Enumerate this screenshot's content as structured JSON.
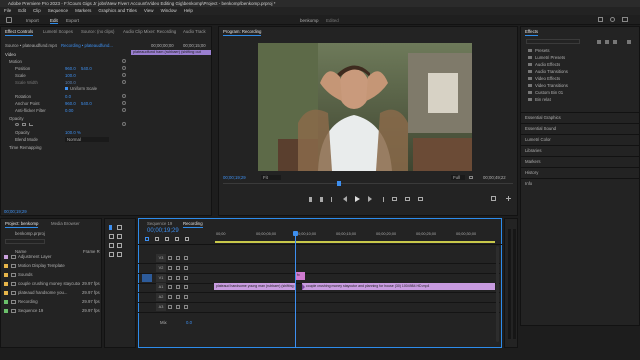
{
  "app": {
    "title": "Adobe Premiere Pro 2023 - F:\\Cours Gigs Jr jobs\\New Fiverr Account\\Video Editing Gig\\benkomp\\Project - benkomp\\benkomp.prproj *",
    "menus": [
      "File",
      "Edit",
      "Clip",
      "Sequence",
      "Markers",
      "Graphics and Titles",
      "View",
      "Window",
      "Help"
    ],
    "workspace_tabs": [
      "Import",
      "Edit",
      "Export"
    ],
    "active_workspace": "Edit",
    "project_center": "benkomp",
    "project_center_status": "Edited"
  },
  "effect_controls": {
    "tabs": [
      "Effect Controls",
      "Lumetri Scopes",
      "Source: (no clips)",
      "Audio Clip Mixer: Recording",
      "Audio Track"
    ],
    "source_label": "Source • plateaudfund.mp4",
    "sequence_label": "Recording • plateaudfund...",
    "ruler_times": [
      "00;00;00;00",
      "00;00;15;00"
    ],
    "clip_bar_label": "plateaudfund ham (ruhbaer) (shifting out",
    "section_video": "Video",
    "fx_motion": "Motion",
    "rows": [
      {
        "label": "Position",
        "v1": "960.0",
        "v2": "540.0"
      },
      {
        "label": "Scale",
        "v1": "100.0",
        "v2": ""
      },
      {
        "label": "Scale Width",
        "v1": "100.0",
        "v2": ""
      },
      {
        "label": "Uniform Scale",
        "v1": "",
        "v2": ""
      },
      {
        "label": "Rotation",
        "v1": "0.0",
        "v2": ""
      },
      {
        "label": "Anchor Point",
        "v1": "960.0",
        "v2": "540.0"
      },
      {
        "label": "Anti-flicker Filter",
        "v1": "0.00",
        "v2": ""
      }
    ],
    "fx_opacity": "Opacity",
    "opacity_rows": [
      {
        "label": "Opacity",
        "v1": "100.0 %"
      },
      {
        "label": "Blend Mode",
        "v1": "Normal"
      }
    ],
    "fx_time_remap": "Time Remapping",
    "bottom_time": "00;00;19;29"
  },
  "program_monitor": {
    "title": "Program: Recording",
    "timecode_left": "00;00;19;29",
    "fit": "Fit",
    "quality": "Full",
    "timecode_right": "00;00;49;22"
  },
  "effects_panel": {
    "title": "Effects",
    "items": [
      "Presets",
      "Lumetri Presets",
      "Audio Effects",
      "Audio Transitions",
      "Video Effects",
      "Video Transitions",
      "Custom Bin 01",
      "Bin relat"
    ],
    "sections": [
      "Essential Graphics",
      "Essential Sound",
      "Lumetri Color",
      "Libraries",
      "Markers",
      "History",
      "Info"
    ]
  },
  "project_panel": {
    "tabs": [
      "Project: benkomp",
      "Media Browser"
    ],
    "path": "benkomp.prproj",
    "col_name": "Name",
    "col_fps": "Frame R",
    "items": [
      {
        "name": "Adjustment Layer",
        "fps": "",
        "color": "#c9a0dc"
      },
      {
        "name": "Motion Display Template",
        "fps": "",
        "color": "#e8b64a"
      },
      {
        "name": "Sounds",
        "fps": "",
        "color": "#e8b64a"
      },
      {
        "name": "couple crushing money staycutor...",
        "fps": "29.97 fps",
        "color": "#e8b64a"
      },
      {
        "name": "plateaud handsome you...",
        "fps": "29.97 fps",
        "color": "#e8b64a"
      },
      {
        "name": "Recording",
        "fps": "29.97 fps",
        "color": "#6bc06b"
      },
      {
        "name": "Sequence 19",
        "fps": "29.97 fps",
        "color": "#6bc06b"
      }
    ]
  },
  "timeline": {
    "tabs": [
      "Sequence 19",
      "Recording"
    ],
    "active_tab": "Recording",
    "timecode": "00;00;19;29",
    "ruler": [
      "00;00",
      "00;00;05;00",
      "00;00;10;00",
      "00;00;15;00",
      "00;00;20;00",
      "00;00;25;00",
      "00;00;30;00"
    ],
    "tracks_video": [
      "V3",
      "V2",
      "V1"
    ],
    "tracks_audio": [
      "A1",
      "A2",
      "A3"
    ],
    "master": "Mix",
    "master_value": "0.0",
    "clip_v1_a": "plateaud handsome young man (ruhbaer) (shifting out)",
    "clip_v1_b": "couple crushing money staycutor and planning for house (30) 1004984 HD.mp4",
    "clip_v2_label": "fx"
  }
}
